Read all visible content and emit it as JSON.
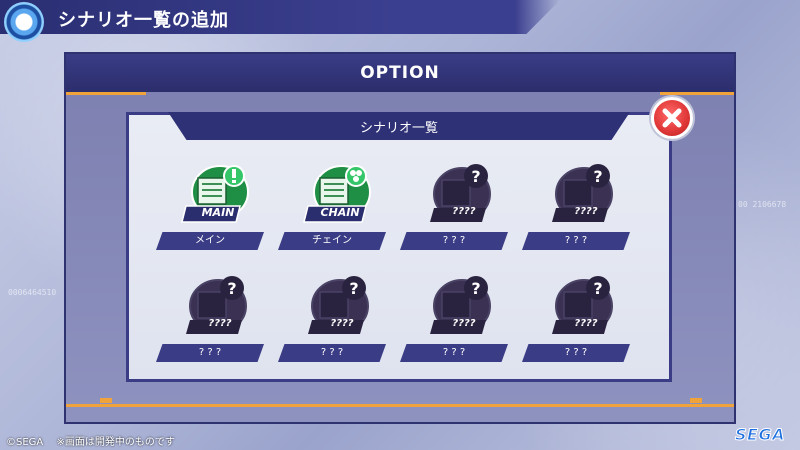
{
  "header": {
    "title": "シナリオ一覧の追加"
  },
  "option": {
    "title": "OPTION"
  },
  "panel": {
    "title": "シナリオ一覧"
  },
  "scenarios": [
    {
      "label": "メイン",
      "badge": "MAIN",
      "locked": false,
      "icon": "main-scenario-icon"
    },
    {
      "label": "チェイン",
      "badge": "CHAIN",
      "locked": false,
      "icon": "chain-scenario-icon"
    },
    {
      "label": "? ? ?",
      "badge": "????",
      "locked": true,
      "icon": "locked-scenario-icon"
    },
    {
      "label": "? ? ?",
      "badge": "????",
      "locked": true,
      "icon": "locked-scenario-icon"
    },
    {
      "label": "? ? ?",
      "badge": "????",
      "locked": true,
      "icon": "locked-scenario-icon"
    },
    {
      "label": "? ? ?",
      "badge": "????",
      "locked": true,
      "icon": "locked-scenario-icon"
    },
    {
      "label": "? ? ?",
      "badge": "????",
      "locked": true,
      "icon": "locked-scenario-icon"
    },
    {
      "label": "? ? ?",
      "badge": "????",
      "locked": true,
      "icon": "locked-scenario-icon"
    }
  ],
  "footer": {
    "copyright": "©SEGA",
    "note": "※画面は開発中のものです",
    "logo": "SEGA"
  },
  "background_codes": [
    "00 2106678",
    "0006464510"
  ],
  "colors": {
    "accent_orange": "#f0a33a",
    "panel_navy": "#3a3d86",
    "unlocked_green": "#2fb25a",
    "close_red": "#e23a3a"
  }
}
